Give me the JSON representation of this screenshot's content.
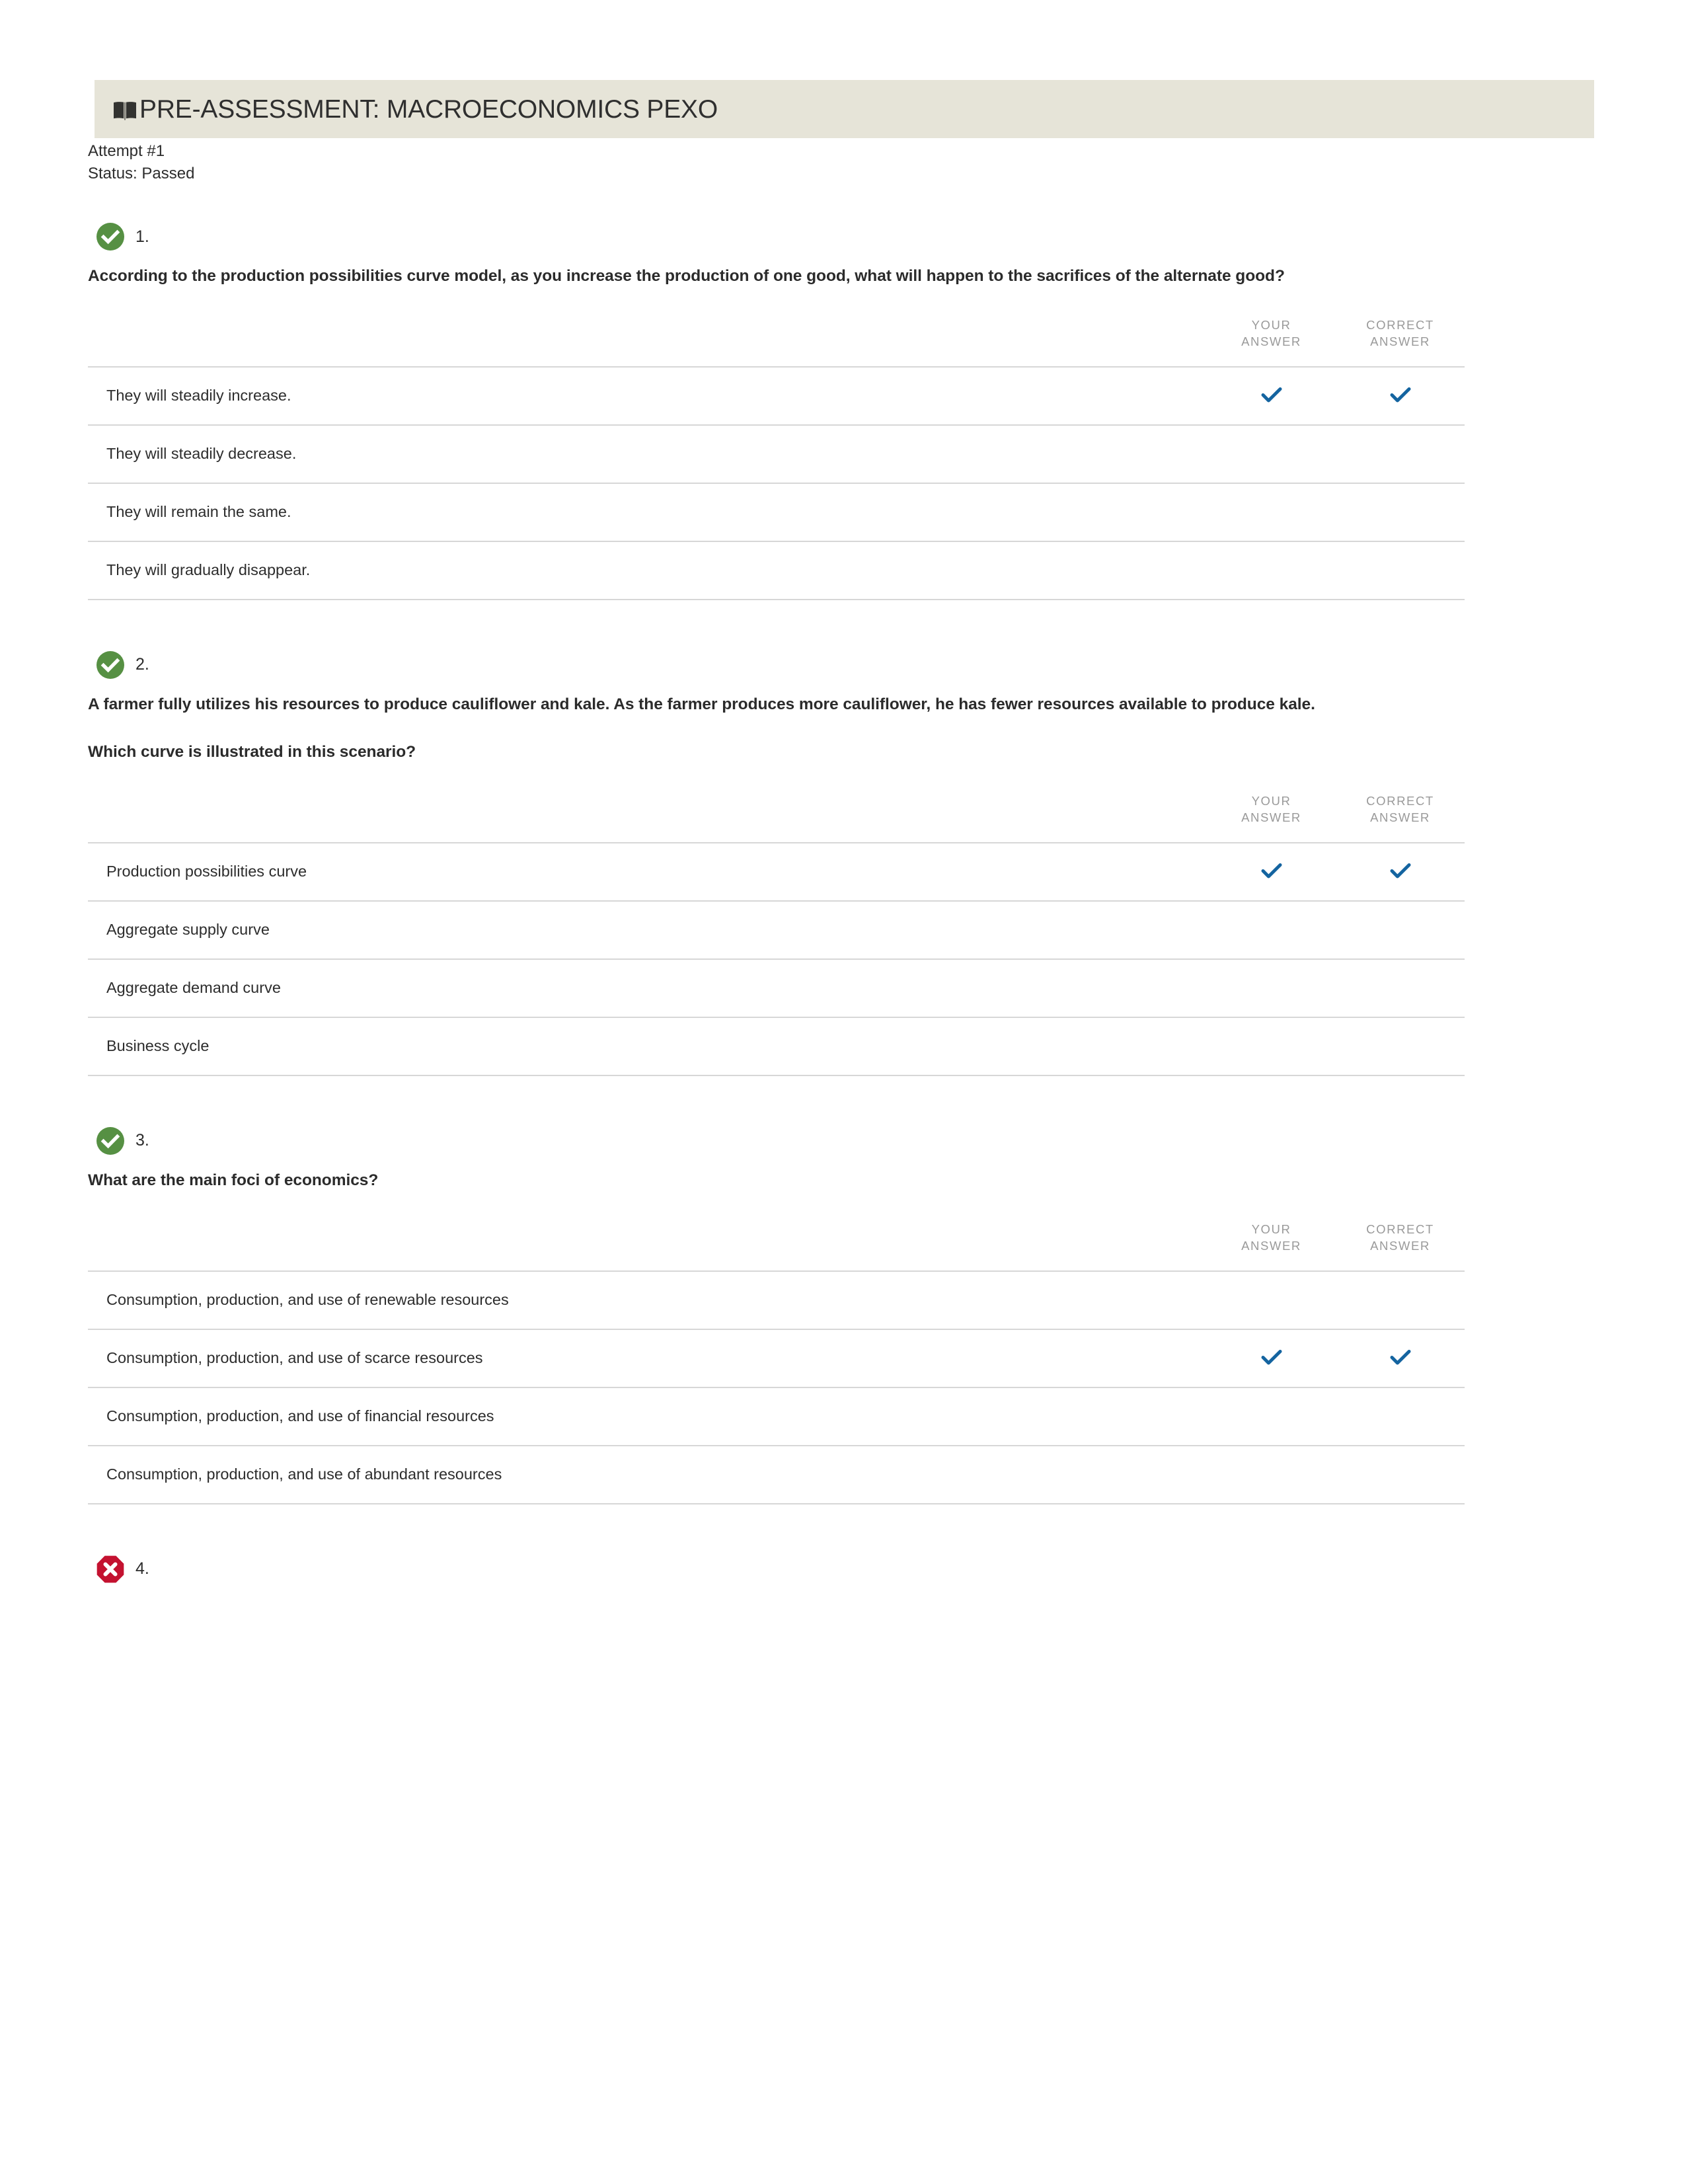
{
  "header": {
    "icon": "open-book-icon",
    "title": "PRE-ASSESSMENT: MACROECONOMICS PEXO",
    "band_color": "#e6e4d8"
  },
  "meta": {
    "attempt": "Attempt #1",
    "status": "Status: Passed"
  },
  "table_headers": {
    "your_answer_line1": "YOUR",
    "your_answer_line2": "ANSWER",
    "correct_answer_line1": "CORRECT",
    "correct_answer_line2": "ANSWER"
  },
  "colors": {
    "correct_badge": "#569043",
    "incorrect_badge": "#c41230",
    "tick": "#1464a0",
    "rule": "#d7d7d7"
  },
  "questions": [
    {
      "number": "1.",
      "status": "correct",
      "status_icon": "check-circle-icon",
      "prompt": "According to the production possibilities curve model, as you increase the production of one good, what will happen to the sacrifices of the alternate good?",
      "prompt2": "",
      "options": [
        {
          "text": "They will steadily increase.",
          "your_answer": true,
          "correct_answer": true
        },
        {
          "text": "They will steadily decrease.",
          "your_answer": false,
          "correct_answer": false
        },
        {
          "text": "They will remain the same.",
          "your_answer": false,
          "correct_answer": false
        },
        {
          "text": "They will gradually disappear.",
          "your_answer": false,
          "correct_answer": false
        }
      ]
    },
    {
      "number": "2.",
      "status": "correct",
      "status_icon": "check-circle-icon",
      "prompt": "A farmer fully utilizes his resources to produce cauliflower and kale. As the farmer produces more cauliflower, he has fewer resources available to produce kale.",
      "prompt2": "Which curve is illustrated in this scenario?",
      "options": [
        {
          "text": "Production possibilities curve",
          "your_answer": true,
          "correct_answer": true
        },
        {
          "text": "Aggregate supply curve",
          "your_answer": false,
          "correct_answer": false
        },
        {
          "text": "Aggregate demand curve",
          "your_answer": false,
          "correct_answer": false
        },
        {
          "text": "Business cycle",
          "your_answer": false,
          "correct_answer": false
        }
      ]
    },
    {
      "number": "3.",
      "status": "correct",
      "status_icon": "check-circle-icon",
      "prompt": "What are the main foci of economics?",
      "prompt2": "",
      "options": [
        {
          "text": "Consumption, production, and use of renewable resources",
          "your_answer": false,
          "correct_answer": false
        },
        {
          "text": "Consumption, production, and use of scarce resources",
          "your_answer": true,
          "correct_answer": true
        },
        {
          "text": "Consumption, production, and use of financial resources",
          "your_answer": false,
          "correct_answer": false
        },
        {
          "text": "Consumption, production, and use of abundant resources",
          "your_answer": false,
          "correct_answer": false
        }
      ]
    },
    {
      "number": "4.",
      "status": "incorrect",
      "status_icon": "x-octagon-icon",
      "prompt": "",
      "prompt2": "",
      "options": []
    }
  ]
}
